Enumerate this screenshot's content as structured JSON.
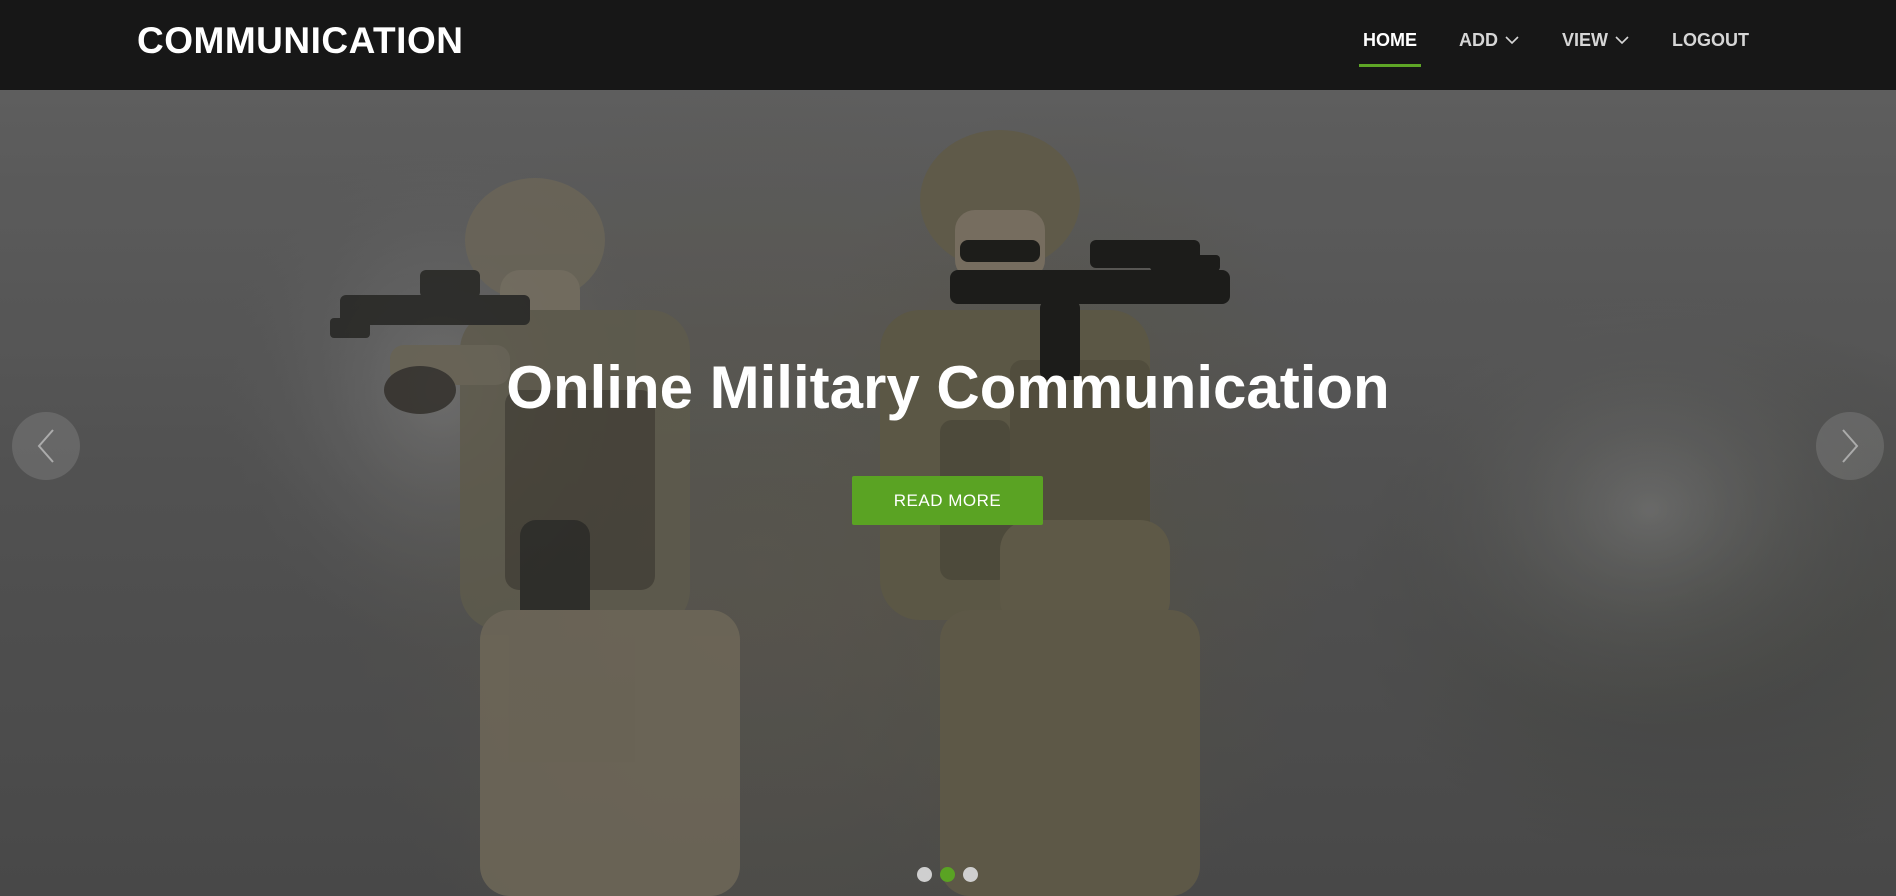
{
  "header": {
    "brand": "COMMUNICATION",
    "nav": [
      {
        "label": "HOME",
        "active": true,
        "dropdown": false
      },
      {
        "label": "ADD",
        "active": false,
        "dropdown": true
      },
      {
        "label": "VIEW",
        "active": false,
        "dropdown": true
      },
      {
        "label": "LOGOUT",
        "active": false,
        "dropdown": false
      }
    ]
  },
  "hero": {
    "title": "Online Military Communication",
    "cta_label": "READ MORE",
    "slides_count": 3,
    "active_slide": 2,
    "prev_icon": "chevron-left-icon",
    "next_icon": "chevron-right-icon"
  },
  "colors": {
    "accent": "#5aa323",
    "header_bg": "#171717"
  }
}
